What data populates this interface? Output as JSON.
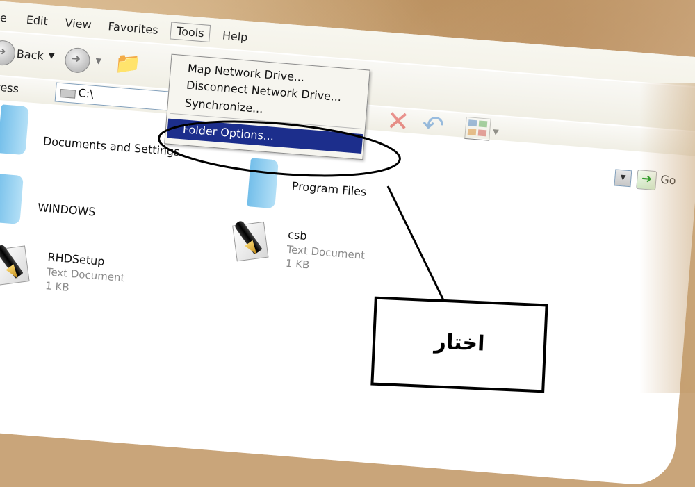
{
  "menubar": {
    "items": [
      {
        "label": "e"
      },
      {
        "label": "Edit"
      },
      {
        "label": "View"
      },
      {
        "label": "Favorites"
      },
      {
        "label": "Tools"
      },
      {
        "label": "Help"
      }
    ]
  },
  "toolbar": {
    "back_label": "Back",
    "address_label": "ddress",
    "address_value": "C:\\",
    "go_label": "Go"
  },
  "tools_menu": {
    "items": [
      {
        "label": "Map Network Drive..."
      },
      {
        "label": "Disconnect Network Drive..."
      },
      {
        "label": "Synchronize..."
      },
      {
        "label": "Folder Options..."
      }
    ],
    "highlighted_index": 3
  },
  "files": [
    {
      "name": "Documents and Settings",
      "type": "",
      "size": ""
    },
    {
      "name": "Program Files",
      "type": "",
      "size": ""
    },
    {
      "name": "WINDOWS",
      "type": "",
      "size": ""
    },
    {
      "name": "csb",
      "type": "Text Document",
      "size": "1 KB"
    },
    {
      "name": "RHDSetup",
      "type": "Text Document",
      "size": "1 KB"
    }
  ],
  "callout": {
    "text": "اختار"
  },
  "colors": {
    "highlight": "#1c2e8c",
    "background": "#c9a57a",
    "delete_icon": "#e02020",
    "undo_icon": "#2f7fd8"
  }
}
